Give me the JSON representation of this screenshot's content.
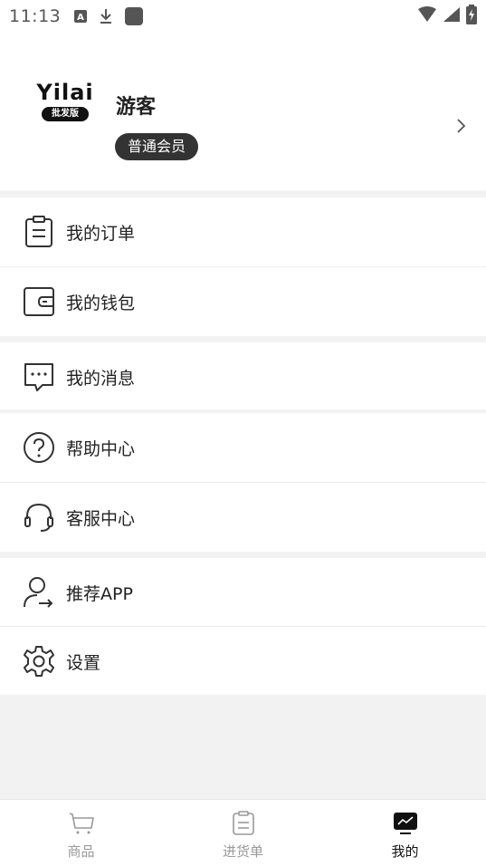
{
  "status_bar": {
    "time": "11:13",
    "icons": [
      "a-notification-icon",
      "download-icon",
      "app-notification-icon"
    ],
    "right_icons": [
      "wifi-icon",
      "signal-icon",
      "battery-charging-icon"
    ]
  },
  "profile": {
    "logo_text": "Yilai",
    "logo_badge": "批发版",
    "username": "游客",
    "member_level": "普通会员",
    "chevron_icon": "chevron-right-icon"
  },
  "menu": {
    "orders": {
      "label": "我的订单",
      "icon": "clipboard-icon"
    },
    "wallet": {
      "label": "我的钱包",
      "icon": "wallet-icon"
    },
    "messages": {
      "label": "我的消息",
      "icon": "chat-bubble-icon"
    },
    "help": {
      "label": "帮助中心",
      "icon": "question-circle-icon"
    },
    "service": {
      "label": "客服中心",
      "icon": "headset-icon"
    },
    "recommend": {
      "label": "推荐APP",
      "icon": "user-share-icon"
    },
    "settings": {
      "label": "设置",
      "icon": "gear-icon"
    }
  },
  "tab_bar": {
    "tabs": [
      {
        "label": "商品",
        "icon": "cart-icon",
        "active": false
      },
      {
        "label": "进货单",
        "icon": "list-icon",
        "active": false
      },
      {
        "label": "我的",
        "icon": "chart-icon",
        "active": true
      }
    ]
  },
  "colors": {
    "background": "#ffffff",
    "section_gap": "#f2f2f2",
    "text_primary": "#222222",
    "tab_inactive": "#999999",
    "tab_active": "#111111",
    "badge_bg": "#333333"
  }
}
